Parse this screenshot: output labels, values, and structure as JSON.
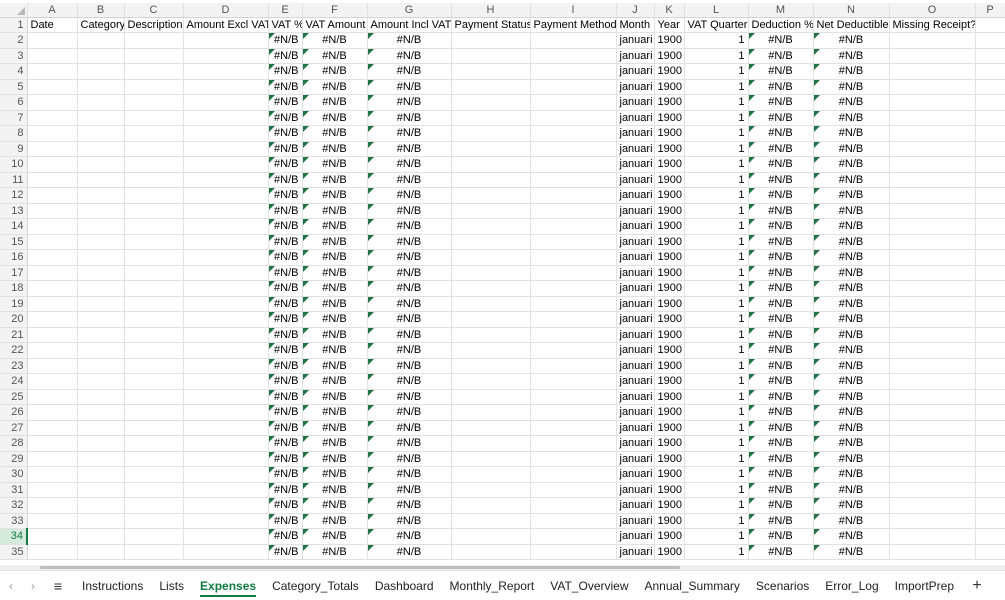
{
  "columns": [
    "A",
    "B",
    "C",
    "D",
    "E",
    "F",
    "G",
    "H",
    "I",
    "J",
    "K",
    "L",
    "M",
    "N",
    "O",
    "P"
  ],
  "header_row": {
    "number": "1",
    "cells": [
      "Date",
      "Category",
      "Description",
      "Amount Excl VAT",
      "VAT %",
      "VAT Amount",
      "Amount Incl VAT",
      "Payment Status",
      "Payment Method",
      "Month",
      "Year",
      "VAT Quarter",
      "Deduction %",
      "Net Deductible",
      "Missing Receipt?",
      ""
    ]
  },
  "data_rows": {
    "first_row_number": 2,
    "last_row_number": 35,
    "selected_row_number": 34,
    "values": {
      "vat_pct": "#N/B",
      "vat_amount": "#N/B",
      "amount_incl_vat": "#N/B",
      "month": "januari",
      "year": "1900",
      "vat_quarter": "1",
      "deduction_pct": "#N/B",
      "net_deductible": "#N/B"
    }
  },
  "sheet_tabs": {
    "items": [
      "Instructions",
      "Lists",
      "Expenses",
      "Category_Totals",
      "Dashboard",
      "Monthly_Report",
      "VAT_Overview",
      "Annual_Summary",
      "Scenarios",
      "Error_Log",
      "ImportPrep"
    ],
    "active": "Expenses",
    "add_label": "+",
    "menu_icon": "hamburger-menu-icon",
    "prev_icon": "chevron-left-icon",
    "next_icon": "chevron-right-icon"
  },
  "colors": {
    "accent": "#107c41",
    "error_flag": "#217346",
    "header_bg": "#f3f3f3",
    "gridline": "#e1e1e1"
  }
}
